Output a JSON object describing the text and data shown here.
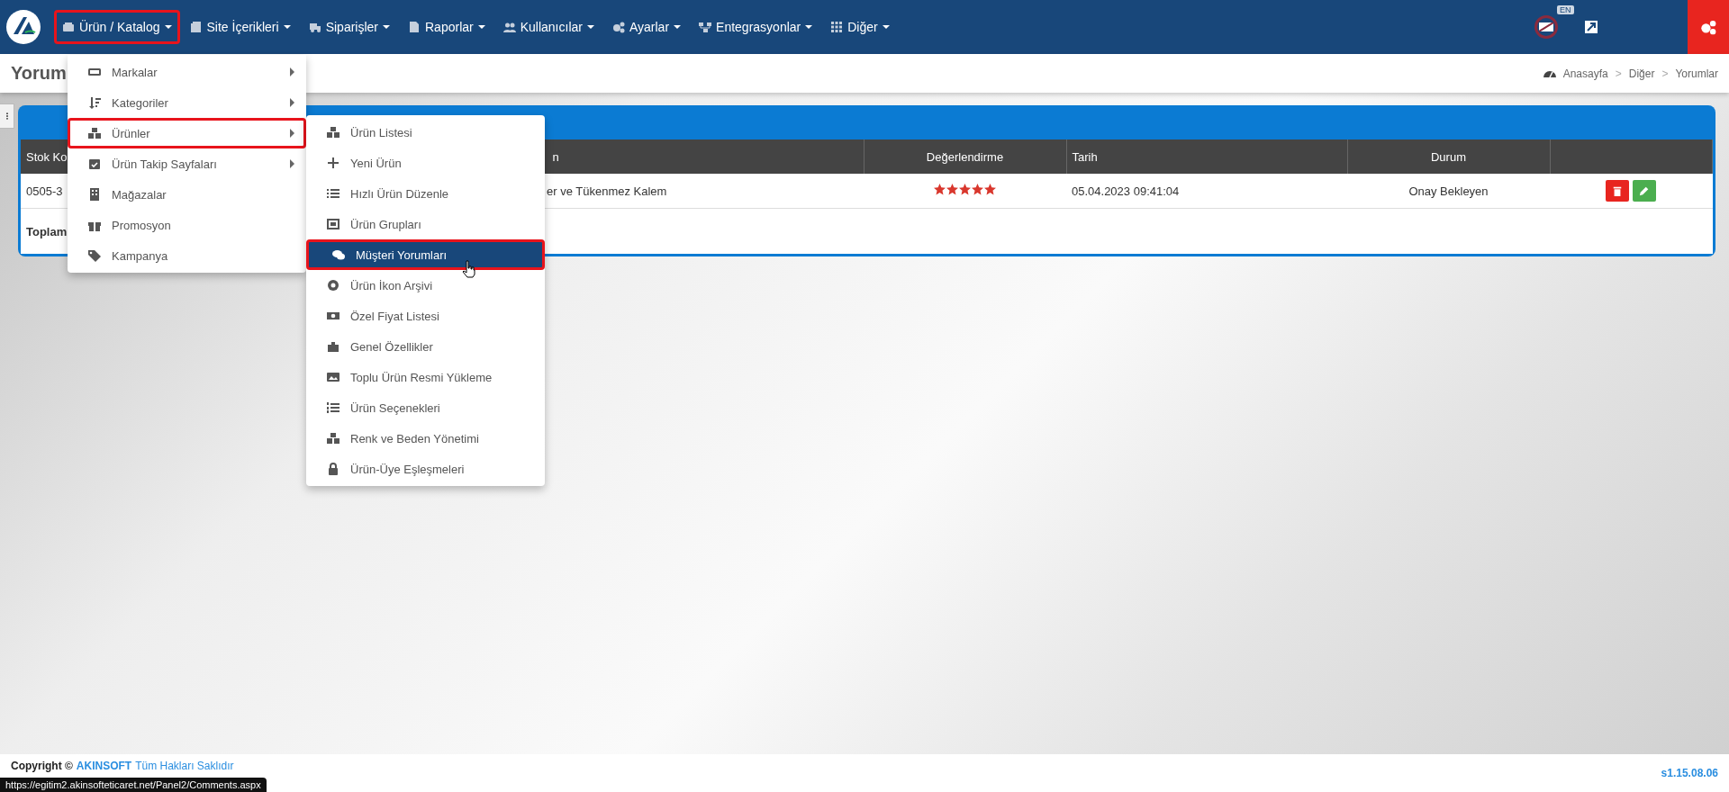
{
  "nav": {
    "items": [
      {
        "label": "Ürün / Katalog",
        "highlighted": true
      },
      {
        "label": "Site İçerikleri",
        "highlighted": false
      },
      {
        "label": "Siparişler",
        "highlighted": false
      },
      {
        "label": "Raporlar",
        "highlighted": false
      },
      {
        "label": "Kullanıcılar",
        "highlighted": false
      },
      {
        "label": "Ayarlar",
        "highlighted": false
      },
      {
        "label": "Entegrasyonlar",
        "highlighted": false
      },
      {
        "label": "Diğer",
        "highlighted": false
      }
    ],
    "language_badge": "EN"
  },
  "page": {
    "title": "Yorum",
    "breadcrumb": [
      {
        "label": "Anasayfa"
      },
      {
        "separator": ">",
        "label": "Diğer"
      },
      {
        "separator": ">",
        "label": "Yorumlar"
      }
    ]
  },
  "table": {
    "columns": [
      "Stok Ko",
      "n",
      "Değerlendirme",
      "Tarih",
      "Durum"
    ],
    "rows": [
      {
        "stok": "0505-3",
        "column_2": "er ve Tükenmez Kalem",
        "stars": 5,
        "tarih": "05.04.2023 09:41:04",
        "durum": "Onay Bekleyen"
      }
    ],
    "total_label": "Toplam"
  },
  "menu": {
    "items": [
      {
        "label": "Markalar",
        "has_submenu": true,
        "highlighted": false
      },
      {
        "label": "Kategoriler",
        "has_submenu": true,
        "highlighted": false
      },
      {
        "label": "Ürünler",
        "has_submenu": true,
        "highlighted": true
      },
      {
        "label": "Ürün Takip Sayfaları",
        "has_submenu": true,
        "highlighted": false
      },
      {
        "label": "Mağazalar",
        "has_submenu": false,
        "highlighted": false
      },
      {
        "label": "Promosyon",
        "has_submenu": false,
        "highlighted": false
      },
      {
        "label": "Kampanya",
        "has_submenu": false,
        "highlighted": false
      }
    ]
  },
  "submenu": {
    "items": [
      {
        "label": "Ürün Listesi",
        "selected": false,
        "highlighted": false
      },
      {
        "label": "Yeni Ürün",
        "selected": false,
        "highlighted": false
      },
      {
        "label": "Hızlı Ürün Düzenle",
        "selected": false,
        "highlighted": false
      },
      {
        "label": "Ürün Grupları",
        "selected": false,
        "highlighted": false
      },
      {
        "label": "Müşteri Yorumları",
        "selected": true,
        "highlighted": true
      },
      {
        "label": "Ürün İkon Arşivi",
        "selected": false,
        "highlighted": false
      },
      {
        "label": "Özel Fiyat Listesi",
        "selected": false,
        "highlighted": false
      },
      {
        "label": "Genel Özellikler",
        "selected": false,
        "highlighted": false
      },
      {
        "label": "Toplu Ürün Resmi Yükleme",
        "selected": false,
        "highlighted": false
      },
      {
        "label": "Ürün Seçenekleri",
        "selected": false,
        "highlighted": false
      },
      {
        "label": "Renk ve Beden Yönetimi",
        "selected": false,
        "highlighted": false
      },
      {
        "label": "Ürün-Üye Eşleşmeleri",
        "selected": false,
        "highlighted": false
      }
    ]
  },
  "footer": {
    "copyright": "Copyright ©",
    "brand": "AKINSOFT",
    "rights": "Tüm Hakları Saklıdır",
    "version": "s1.15.08.06"
  },
  "status_bar": {
    "url": "https://egitim2.akinsofteticaret.net/Panel2/Comments.aspx"
  }
}
